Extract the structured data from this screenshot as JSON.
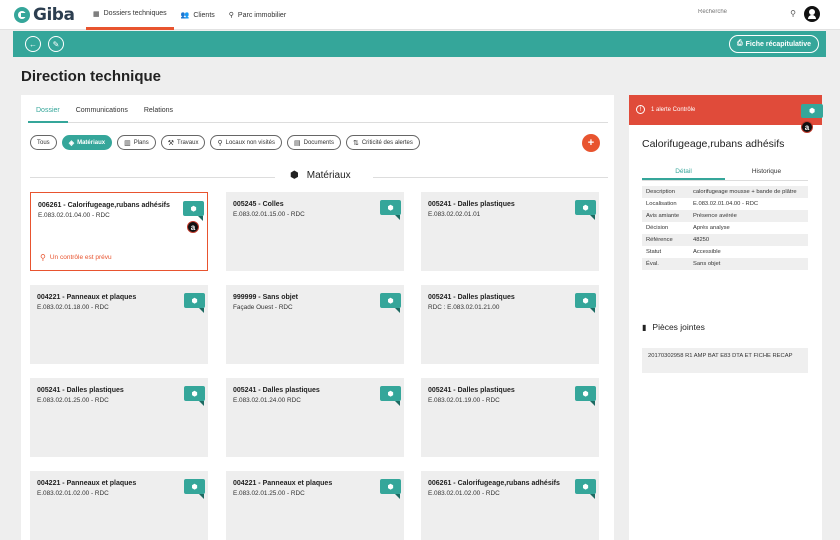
{
  "app": {
    "logo_text": "Giba"
  },
  "nav": [
    {
      "label": "Dossiers techniques",
      "icon": "grid-icon",
      "active": true
    },
    {
      "label": "Clients",
      "icon": "users-icon"
    },
    {
      "label": "Parc immobilier",
      "icon": "map-marker-icon"
    }
  ],
  "search": {
    "placeholder": "Recherche"
  },
  "toolbar": {
    "fiche_label": "Fiche récapitulative"
  },
  "page": {
    "title": "Direction technique"
  },
  "tabs": [
    "Dossier",
    "Communications",
    "Relations"
  ],
  "filters": [
    "Tous",
    "Matériaux",
    "Plans",
    "Travaux",
    "Locaux non visités",
    "Documents",
    "Criticité des alertes"
  ],
  "section": {
    "title": "Matériaux"
  },
  "cards": [
    {
      "title": "006261 - Calorifugeage,rubans adhésifs",
      "sub": "E.083.02.01.04.00 - RDC",
      "alert": "Un contrôle est prévu",
      "flag": "a"
    },
    {
      "title": "005245 - Colles",
      "sub": "E.083.02.01.15.00 - RDC"
    },
    {
      "title": "005241 - Dalles plastiques",
      "sub": "E.083.02.02.01.01"
    },
    {
      "title": "004221 - Panneaux et plaques",
      "sub": "E.083.02.01.18.00 - RDC"
    },
    {
      "title": "999999 - Sans objet",
      "sub": "Façade Ouest - RDC"
    },
    {
      "title": "005241 - Dalles plastiques",
      "sub": "RDC : E.083.02.01.21.00"
    },
    {
      "title": "005241 - Dalles plastiques",
      "sub": "E.083.02.01.25.00 - RDC"
    },
    {
      "title": "005241 - Dalles plastiques",
      "sub": "E.083.02.01.24.00 RDC"
    },
    {
      "title": "005241 - Dalles plastiques",
      "sub": "E.083.02.01.19.00 - RDC"
    },
    {
      "title": "004221 - Panneaux et plaques",
      "sub": "E.083.02.01.02.00 - RDC"
    },
    {
      "title": "004221 - Panneaux et plaques",
      "sub": "E.083.02.01.25.00 - RDC"
    },
    {
      "title": "006261 - Calorifugeage,rubans adhésifs",
      "sub": "E.083.02.01.02.00 - RDC"
    }
  ],
  "side": {
    "alert": "1 alerte Contrôle",
    "flag": "a",
    "title": "Calorifugeage,rubans adhésifs",
    "tabs": [
      "Détail",
      "Historique"
    ],
    "props": [
      {
        "k": "Description",
        "v": "calorifugeage mousse + bande de plâtre"
      },
      {
        "k": "Localisation",
        "v": "E.083.02.01.04.00 - RDC"
      },
      {
        "k": "Avis amiante",
        "v": "Présence avérée"
      },
      {
        "k": "Décision",
        "v": "Après analyse"
      },
      {
        "k": "Référence",
        "v": "48250"
      },
      {
        "k": "Statut",
        "v": "Accessible"
      },
      {
        "k": "Éval.",
        "v": "Sans objet"
      }
    ],
    "pj_title": "Pièces jointes",
    "pj_item": "20170302958 R1 AMP BAT E83 DTA ET FICHE RECAP"
  }
}
